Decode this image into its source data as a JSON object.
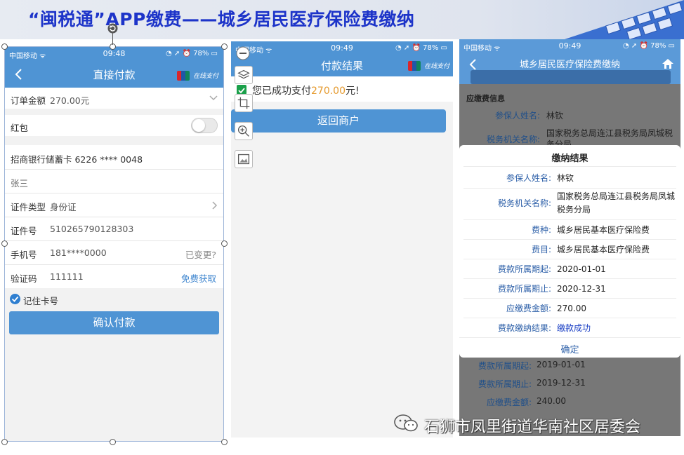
{
  "slide": {
    "title": "“闽税通”APP缴费——城乡居民医疗保险费缴纳",
    "watermark": "石狮市凤里街道华南社区居委会"
  },
  "colors": {
    "title_blue": "#1d34c9",
    "nav_blue": "#4f94d4",
    "amount_orange": "#e59a2e",
    "success_blue": "#1a3fc4"
  },
  "phone1": {
    "status": {
      "carrier": "中国移动",
      "time": "09:48",
      "battery": "78%"
    },
    "nav": {
      "title": "直接付款",
      "logo_text": "在线支付"
    },
    "order": {
      "label": "订单金额",
      "value": "270.00元"
    },
    "red_packet": {
      "label": "红包"
    },
    "card": {
      "value": "招商银行储蓄卡 6226 **** 0048"
    },
    "name": {
      "value": "张三"
    },
    "id_type": {
      "label": "证件类型",
      "value": "身份证"
    },
    "id_no": {
      "label": "证件号",
      "value": "510265790128303"
    },
    "phone": {
      "label": "手机号",
      "value": "181****0000",
      "change": "已变更?"
    },
    "code": {
      "label": "验证码",
      "value": "111111",
      "get": "免费获取"
    },
    "remember": "记住卡号",
    "confirm": "确认付款"
  },
  "phone2": {
    "status": {
      "carrier": "中国移动",
      "time": "09:49",
      "battery": "78%"
    },
    "nav": {
      "title": "付款结果",
      "logo_text": "在线支付"
    },
    "msg_prefix": "您已成功支付",
    "amount": "270.00",
    "msg_suffix": "元!",
    "back_button": "返回商户"
  },
  "phone3": {
    "status": {
      "carrier": "中国移动",
      "time": "09:49",
      "battery": "78%"
    },
    "nav": {
      "title": "城乡居民医疗保险费缴纳"
    },
    "section": "应缴费信息",
    "bg_rows": [
      {
        "k": "参保人姓名:",
        "v": "林钦"
      },
      {
        "k": "税务机关名称:",
        "v": "国家税务总局连江县税务局凤城税务分局"
      }
    ],
    "modal": {
      "title": "缴纳结果",
      "rows": [
        {
          "k": "参保人姓名:",
          "v": "林钦"
        },
        {
          "k": "税务机关名称:",
          "v": "国家税务总局连江县税务局凤城税务分局"
        },
        {
          "k": "费种:",
          "v": "城乡居民基本医疗保险费"
        },
        {
          "k": "费目:",
          "v": "城乡居民基本医疗保险费"
        },
        {
          "k": "费款所属期起:",
          "v": "2020-01-01"
        },
        {
          "k": "费款所属期止:",
          "v": "2020-12-31"
        },
        {
          "k": "应缴费金额:",
          "v": "270.00"
        },
        {
          "k": "费款缴纳结果:",
          "v": "缴款成功"
        }
      ],
      "ok": "确定"
    },
    "bg_rows_after": [
      {
        "k": "费款所属期起:",
        "v": "2019-01-01"
      },
      {
        "k": "费款所属期止:",
        "v": "2019-12-31"
      },
      {
        "k": "应缴费金额:",
        "v": "240.00"
      }
    ]
  }
}
